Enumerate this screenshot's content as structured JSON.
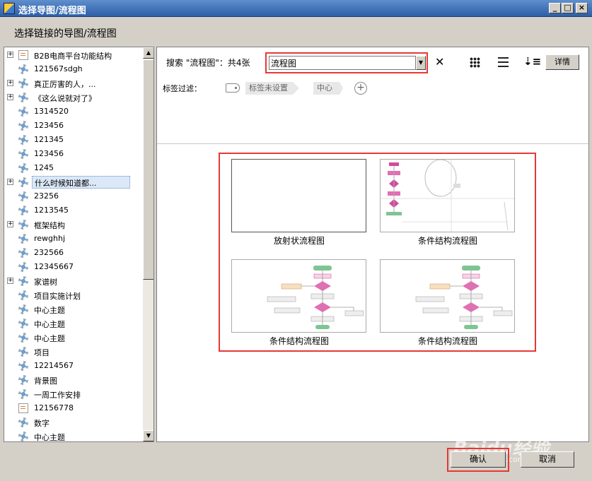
{
  "window": {
    "title": "选择导图/流程图",
    "minimize": "_",
    "maximize": "□",
    "close": "×"
  },
  "heading": "选择链接的导图/流程图",
  "tree": {
    "items": [
      {
        "label": "B2B电商平台功能结构",
        "icon": "document-icon",
        "expandable": true
      },
      {
        "label": "121567sdgh",
        "icon": "mindmap-icon",
        "expandable": false
      },
      {
        "label": "真正厉害的人，...",
        "icon": "mindmap-icon",
        "expandable": true
      },
      {
        "label": "《这么说就对了》",
        "icon": "mindmap-icon",
        "expandable": true
      },
      {
        "label": "1314520",
        "icon": "mindmap-icon",
        "expandable": false
      },
      {
        "label": "123456",
        "icon": "mindmap-icon",
        "expandable": false
      },
      {
        "label": "121345",
        "icon": "mindmap-icon",
        "expandable": false
      },
      {
        "label": "123456",
        "icon": "mindmap-icon",
        "expandable": false
      },
      {
        "label": "1245",
        "icon": "mindmap-icon",
        "expandable": false
      },
      {
        "label": "什么时候知道都...",
        "icon": "mindmap-icon",
        "expandable": true,
        "selected": true
      },
      {
        "label": "23256",
        "icon": "mindmap-icon",
        "expandable": false
      },
      {
        "label": "1213545",
        "icon": "mindmap-icon",
        "expandable": false
      },
      {
        "label": "框架结构",
        "icon": "mindmap-icon",
        "expandable": true
      },
      {
        "label": "rewghhj",
        "icon": "mindmap-icon",
        "expandable": false
      },
      {
        "label": "232566",
        "icon": "mindmap-icon",
        "expandable": false
      },
      {
        "label": "12345667",
        "icon": "mindmap-icon",
        "expandable": false
      },
      {
        "label": "家谱树",
        "icon": "mindmap-icon",
        "expandable": true
      },
      {
        "label": "项目实施计划",
        "icon": "mindmap-icon",
        "expandable": false
      },
      {
        "label": "中心主题",
        "icon": "mindmap-icon",
        "expandable": false
      },
      {
        "label": "中心主题",
        "icon": "mindmap-icon",
        "expandable": false
      },
      {
        "label": "中心主题",
        "icon": "mindmap-icon",
        "expandable": false
      },
      {
        "label": "项目",
        "icon": "mindmap-icon",
        "expandable": false
      },
      {
        "label": "12214567",
        "icon": "mindmap-icon",
        "expandable": false
      },
      {
        "label": "背景图",
        "icon": "mindmap-icon",
        "expandable": false
      },
      {
        "label": "一周工作安排",
        "icon": "mindmap-icon",
        "expandable": false
      },
      {
        "label": "12156778",
        "icon": "document-icon",
        "expandable": false
      },
      {
        "label": "数字",
        "icon": "mindmap-icon",
        "expandable": false
      },
      {
        "label": "中心主题",
        "icon": "mindmap-icon",
        "expandable": false
      }
    ]
  },
  "search": {
    "label": "搜索 \"流程图\"：共4张",
    "value": "流程图"
  },
  "toolbar": {
    "detail_label": "详情"
  },
  "tags": {
    "label": "标签过滤：",
    "chips": [
      "标签未设置",
      "中心"
    ]
  },
  "results": [
    {
      "caption": "放射状流程图",
      "preview": "empty"
    },
    {
      "caption": "条件结构流程图",
      "preview": "flow-a"
    },
    {
      "caption": "条件结构流程图",
      "preview": "flow-b"
    },
    {
      "caption": "条件结构流程图",
      "preview": "flow-b"
    }
  ],
  "buttons": {
    "ok": "确认",
    "cancel": "取消"
  },
  "watermark": {
    "brand": "Baidu经验",
    "url": "jingyan.baidu.com"
  }
}
